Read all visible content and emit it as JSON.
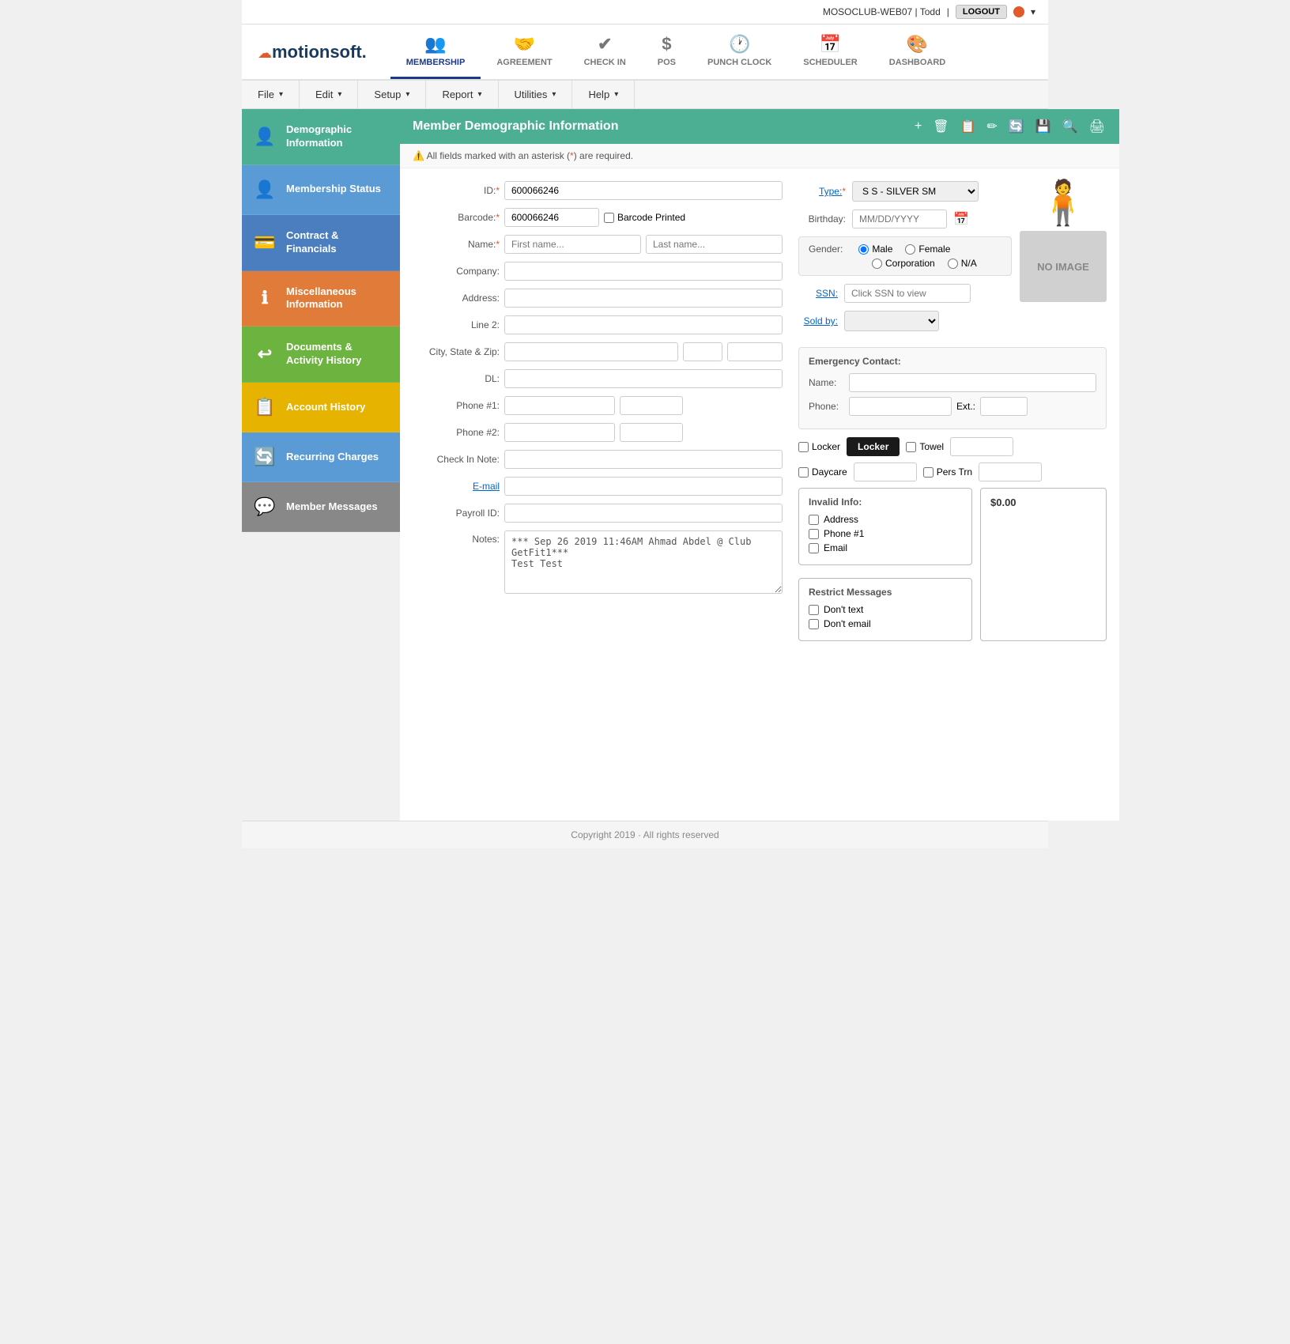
{
  "topbar": {
    "user_info": "MOSOCLUB-WEB07 | Todd",
    "logout_label": "LOGOUT"
  },
  "nav": {
    "logo": "Motionsoft.",
    "items": [
      {
        "label": "MEMBERSHIP",
        "icon": "👥",
        "active": true
      },
      {
        "label": "AGREEMENT",
        "icon": "🤝",
        "active": false
      },
      {
        "label": "CHECK IN",
        "icon": "✔",
        "active": false
      },
      {
        "label": "POS",
        "icon": "$",
        "active": false
      },
      {
        "label": "PUNCH CLOCK",
        "icon": "🕐",
        "active": false
      },
      {
        "label": "SCHEDULER",
        "icon": "📅",
        "active": false
      },
      {
        "label": "DASHBOARD",
        "icon": "🎨",
        "active": false
      }
    ]
  },
  "menu": {
    "items": [
      {
        "label": "File"
      },
      {
        "label": "Edit"
      },
      {
        "label": "Setup"
      },
      {
        "label": "Report"
      },
      {
        "label": "Utilities"
      },
      {
        "label": "Help"
      }
    ]
  },
  "sidebar": {
    "items": [
      {
        "label": "Demographic Information",
        "icon": "👤",
        "color": "#4CAF93",
        "active": true
      },
      {
        "label": "Membership Status",
        "icon": "👤",
        "color": "#5b9bd5",
        "active": false
      },
      {
        "label": "Contract & Financials",
        "icon": "💳",
        "color": "#4a7ebf",
        "active": false
      },
      {
        "label": "Miscellaneous Information",
        "icon": "ℹ",
        "color": "#e07b39",
        "active": false
      },
      {
        "label": "Documents & Activity History",
        "icon": "↩",
        "color": "#6db33f",
        "active": false
      },
      {
        "label": "Account History",
        "icon": "📋",
        "color": "#e6b400",
        "active": false
      },
      {
        "label": "Recurring Charges",
        "icon": "🔄",
        "color": "#5b9bd5",
        "active": false
      },
      {
        "label": "Member Messages",
        "icon": "💬",
        "color": "#888",
        "active": false
      }
    ]
  },
  "panel": {
    "title": "Member Demographic Information",
    "actions": [
      "+",
      "🗑",
      "📋",
      "✏",
      "🔄",
      "💾",
      "🔍",
      "🖨"
    ]
  },
  "warning": {
    "text": "All fields marked with an asterisk (*) are required."
  },
  "form": {
    "id_label": "ID:*",
    "id_value": "600066246",
    "barcode_label": "Barcode:*",
    "barcode_value": "600066246",
    "barcode_printed_label": "Barcode Printed",
    "name_label": "Name:*",
    "first_name_placeholder": "First name...",
    "last_name_placeholder": "Last name...",
    "company_label": "Company:",
    "address_label": "Address:",
    "line2_label": "Line 2:",
    "city_state_zip_label": "City, State & Zip:",
    "dl_label": "DL:",
    "phone1_label": "Phone #1:",
    "phone2_label": "Phone #2:",
    "checkin_note_label": "Check In Note:",
    "email_label": "E-mail",
    "payroll_id_label": "Payroll ID:",
    "notes_label": "Notes:",
    "notes_value": "*** Sep 26 2019 11:46AM Ahmad Abdel @ Club GetFit1***\nTest Test",
    "type_label": "Type:*",
    "type_value": "S S - SILVER SM",
    "birthday_label": "Birthday:",
    "birthday_placeholder": "MM/DD/YYYY",
    "gender_label": "Gender:",
    "gender_options": [
      "Male",
      "Female",
      "Corporation",
      "N/A"
    ],
    "gender_selected": "Male",
    "ssn_label": "SSN:",
    "ssn_placeholder": "Click SSN to view",
    "soldby_label": "Sold by:",
    "no_image_text": "NO IMAGE",
    "emergency_title": "Emergency Contact:",
    "emergency_name_label": "Name:",
    "emergency_phone_label": "Phone:",
    "emergency_ext_label": "Ext.:",
    "locker_label": "Locker",
    "locker_btn": "Locker",
    "towel_label": "Towel",
    "daycare_label": "Daycare",
    "pers_trn_label": "Pers Trn",
    "invalid_title": "Invalid Info:",
    "invalid_items": [
      "Address",
      "Phone #1",
      "Email"
    ],
    "restrict_title": "Restrict Messages",
    "restrict_items": [
      "Don't text",
      "Don't email"
    ],
    "balance": "$0.00"
  },
  "footer": {
    "text": "Copyright 2019 · All rights reserved"
  }
}
